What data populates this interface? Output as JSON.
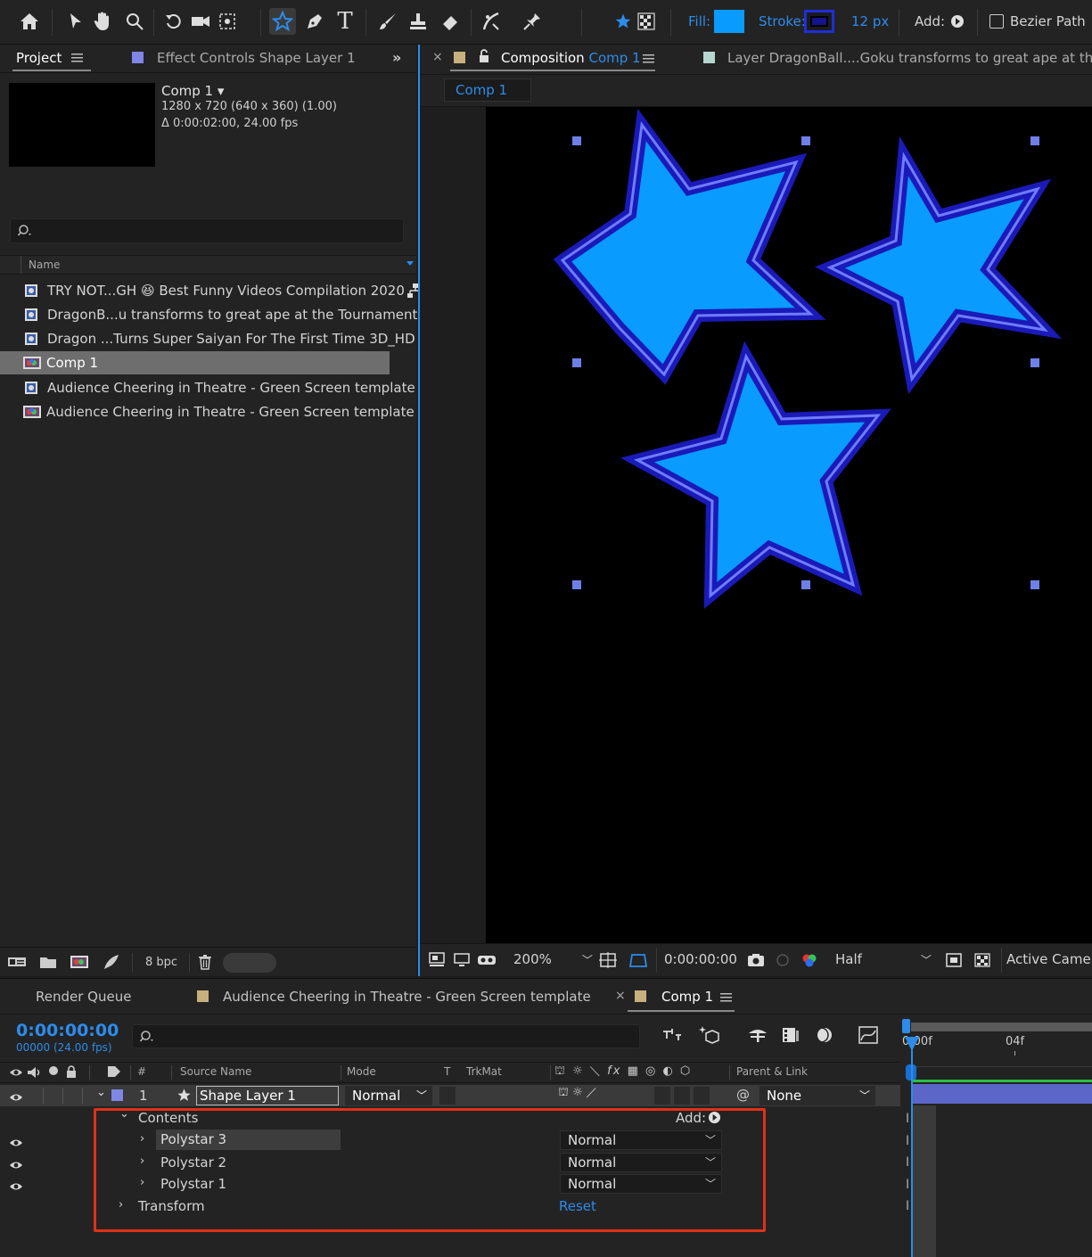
{
  "toolbar": {
    "fill_label": "Fill:",
    "stroke_label": "Stroke:",
    "stroke_width": "12 px",
    "add_label": "Add:",
    "bezier_label": "Bezier Path",
    "fill_color": "#0a9bff",
    "stroke_color": "#1b1bb5"
  },
  "project": {
    "tab_label": "Project",
    "effect_tab_label": "Effect Controls Shape Layer 1",
    "comp_name": "Comp 1 ▾",
    "comp_size": "1280 x 720  (640 x 360) (1.00)",
    "comp_duration": "Δ 0:00:02:00, 24.00 fps",
    "column_name": "Name",
    "items": [
      {
        "label": "TRY NOT...GH 😆 Best Funny Videos Compilation 2020",
        "kind": "footage"
      },
      {
        "label": "DragonB...u transforms to great ape at the Tournament",
        "kind": "footage"
      },
      {
        "label": "Dragon ...Turns Super Saiyan For The First Time 3D_HD",
        "kind": "footage"
      },
      {
        "label": "Comp 1",
        "kind": "comp"
      },
      {
        "label": "Audience Cheering in Theatre - Green Screen template",
        "kind": "footage"
      },
      {
        "label": "Audience Cheering in Theatre - Green Screen template",
        "kind": "comp"
      }
    ],
    "bpc": "8 bpc"
  },
  "composition": {
    "tab_label": "Composition",
    "tab_comp": "Comp 1",
    "layer_tab": "Layer DragonBall....Goku transforms to great ape at the Tou",
    "subtab": "Comp 1",
    "zoom": "200%",
    "timecode": "0:00:00:00",
    "resolution": "Half",
    "camera": "Active Camer"
  },
  "timeline": {
    "tab_render": "Render Queue",
    "tab_audience": "Audience Cheering in Theatre - Green Screen template",
    "tab_comp": "Comp 1",
    "timecode": "0:00:00:00",
    "timecode_sub": "00000 (24.00 fps)",
    "col_hash": "#",
    "col_source": "Source Name",
    "col_mode": "Mode",
    "col_t": "T",
    "col_trkmat": "TrkMat",
    "col_parent": "Parent & Link",
    "layer_num": "1",
    "layer_name": "Shape Layer 1",
    "layer_mode": "Normal",
    "parent": "None",
    "contents": "Contents",
    "add": "Add:",
    "polystars": [
      {
        "name": "Polystar 3",
        "mode": "Normal"
      },
      {
        "name": "Polystar 2",
        "mode": "Normal"
      },
      {
        "name": "Polystar 1",
        "mode": "Normal"
      }
    ],
    "transform": "Transform",
    "reset": "Reset",
    "ruler_0": "0:00f",
    "ruler_1": "04f"
  }
}
